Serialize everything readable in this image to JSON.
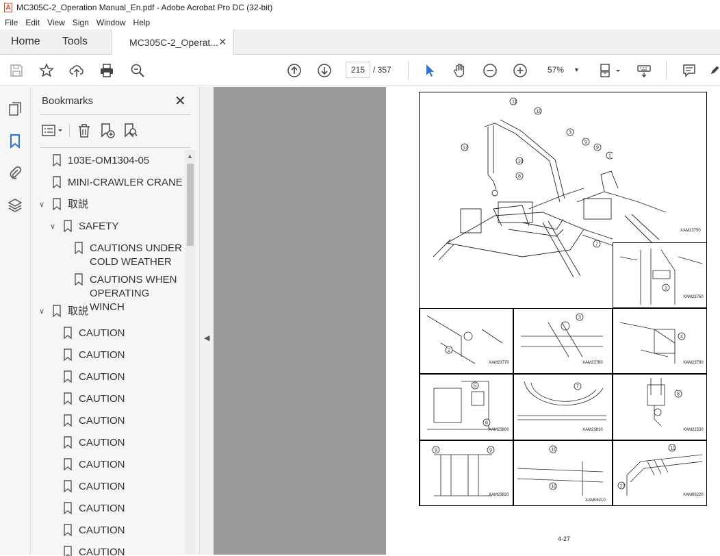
{
  "window": {
    "title": "MC305C-2_Operation Manual_En.pdf - Adobe Acrobat Pro DC (32-bit)"
  },
  "menu": [
    "File",
    "Edit",
    "View",
    "Sign",
    "Window",
    "Help"
  ],
  "tabs": {
    "home": "Home",
    "tools": "Tools",
    "document": "MC305C-2_Operat..."
  },
  "toolbar": {
    "page_current": "215",
    "page_total": "/ 357",
    "zoom": "57%"
  },
  "bookmarks": {
    "title": "Bookmarks",
    "items": [
      {
        "label": "103E-OM1304-05"
      },
      {
        "label": "MINI-CRAWLER CRANE"
      },
      {
        "label": "取説"
      },
      {
        "label": "SAFETY"
      },
      {
        "label": "CAUTIONS UNDER COLD WEATHER"
      },
      {
        "label": "CAUTIONS WHEN OPERATING WINCH"
      },
      {
        "label": "取説"
      },
      {
        "label": "CAUTION"
      },
      {
        "label": "CAUTION"
      },
      {
        "label": "CAUTION"
      },
      {
        "label": "CAUTION"
      },
      {
        "label": "CAUTION"
      },
      {
        "label": "CAUTION"
      },
      {
        "label": "CAUTION"
      },
      {
        "label": "CAUTION"
      },
      {
        "label": "CAUTION"
      },
      {
        "label": "CAUTION"
      },
      {
        "label": "CAUTION"
      }
    ]
  },
  "document": {
    "page_number": "4-27",
    "figure_codes": {
      "main": "XAM23750",
      "c1": "XAM23760",
      "c2": "XAM23770",
      "c3": "XAM23780",
      "c4": "XAM23790",
      "c5": "XAM23800",
      "c6": "XAM23810",
      "c7": "XAM22530",
      "c8": "XAM23820",
      "c9": "XAM06210",
      "c10": "XAM06220"
    }
  },
  "colors": {
    "accent": "#2d6fdb",
    "doc_bg": "#9b9b9b"
  }
}
